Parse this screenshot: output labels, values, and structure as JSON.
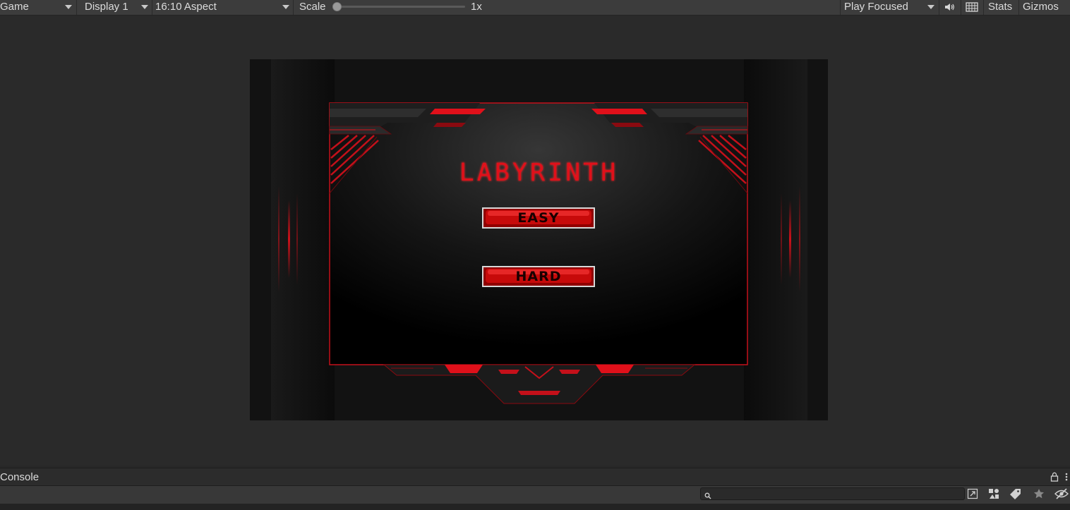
{
  "toolbar": {
    "game_tab": "Game",
    "display": "Display 1",
    "aspect": "16:10 Aspect",
    "scale_label": "Scale",
    "scale_value": "1x",
    "scale_level": 0.0,
    "play_mode": "Play Focused",
    "stats": "Stats",
    "gizmos": "Gizmos"
  },
  "game": {
    "title": "LABYRINTH",
    "buttons": [
      {
        "label": "EASY"
      },
      {
        "label": "HARD"
      }
    ]
  },
  "console": {
    "title": "Console",
    "search_placeholder": ""
  },
  "colors": {
    "accent_red": "#e0101a",
    "panel_bg": "#282828",
    "toolbar_bg": "#3c3c3c"
  },
  "icons": [
    "caret-down-icon",
    "audio-icon",
    "grid-icon",
    "lock-icon",
    "more-icon",
    "search-icon",
    "pin-icon",
    "scene-icon",
    "tag-icon",
    "star-icon",
    "eye-hidden-icon"
  ]
}
